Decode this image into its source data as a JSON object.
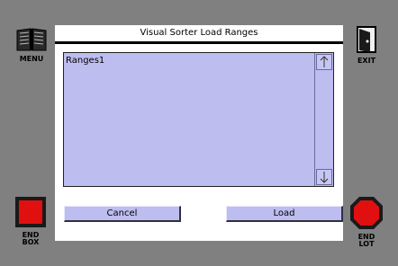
{
  "dialog": {
    "title": "Visual Sorter Load Ranges",
    "list_items": [
      "Ranges1"
    ],
    "cancel_label": "Cancel",
    "load_label": "Load"
  },
  "side_buttons": {
    "menu_label": "MENU",
    "exit_label": "EXIT",
    "end_box_line1": "END",
    "end_box_line2": "BOX",
    "end_lot_line1": "END",
    "end_lot_line2": "LOT"
  },
  "colors": {
    "background": "#808080",
    "list_fill": "#bdbdf0",
    "stop_red": "#e01010"
  },
  "icons": {
    "menu": "book-icon",
    "exit": "exit-door-icon",
    "end_box": "red-square-icon",
    "end_lot": "stop-octagon-icon",
    "scroll_up": "arrow-up-icon",
    "scroll_down": "arrow-down-icon"
  }
}
